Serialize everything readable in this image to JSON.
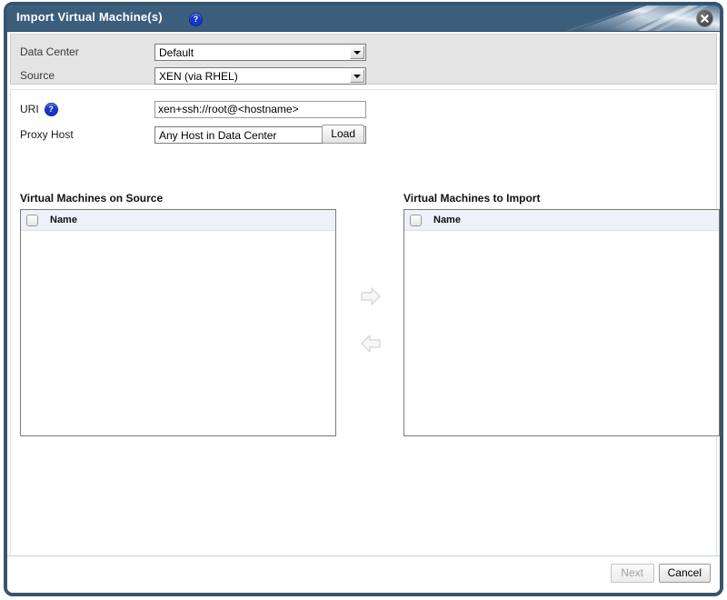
{
  "window": {
    "title": "Import Virtual Machine(s)",
    "title_help_icon": "help-circle-icon",
    "close_icon": "close-icon",
    "accent_color": "#3c5e7d",
    "border_color": "#36546f"
  },
  "form": {
    "data_center": {
      "label": "Data Center",
      "value": "Default",
      "options": [
        "Default"
      ]
    },
    "source": {
      "label": "Source",
      "value": "XEN (via RHEL)",
      "options": [
        "XEN (via RHEL)"
      ]
    },
    "uri": {
      "label": "URI",
      "help_icon": "help-circle-icon",
      "value": "xen+ssh://root@<hostname>",
      "placeholder": "xen+ssh://root@<hostname>"
    },
    "proxy_host": {
      "label": "Proxy Host",
      "value": "Any Host in Data Center",
      "options": [
        "Any Host in Data Center"
      ]
    },
    "load_button": {
      "label": "Load",
      "enabled": true
    }
  },
  "lists": {
    "source": {
      "title": "Virtual Machines on Source",
      "column_header": "Name",
      "select_all_checked": false,
      "rows": []
    },
    "target": {
      "title": "Virtual Machines to Import",
      "column_header": "Name",
      "select_all_checked": false,
      "rows": []
    }
  },
  "transfer": {
    "add_icon": "arrow-right-icon",
    "add_enabled": false,
    "remove_icon": "arrow-left-icon",
    "remove_enabled": false
  },
  "footer": {
    "next_label": "Next",
    "next_enabled": false,
    "cancel_label": "Cancel",
    "cancel_enabled": true
  }
}
